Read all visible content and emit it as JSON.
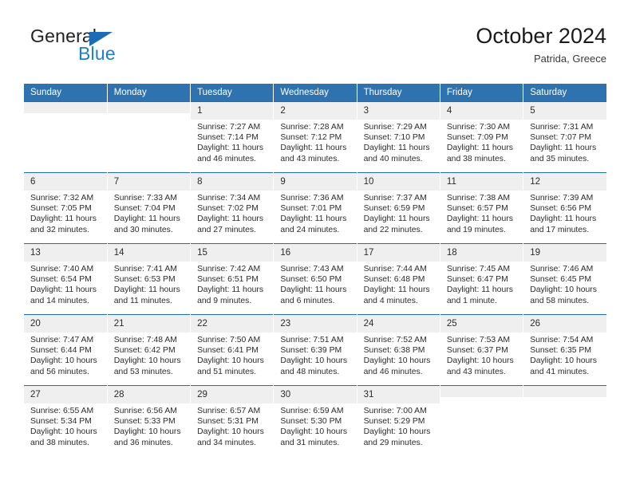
{
  "brand": {
    "name_top": "General",
    "name_bottom": "Blue",
    "triangle_color": "#1b6cb5",
    "text_color": "#231f20",
    "blue_color": "#1b7fd4"
  },
  "header": {
    "title": "October 2024",
    "subtitle": "Patrida, Greece"
  },
  "theme": {
    "header_blue": "#2e73b0",
    "row_divider_blue": "#1f6db5",
    "daynum_band": "#efefef",
    "text": "#2b2b2b"
  },
  "calendar": {
    "weekday_headers": [
      "Sunday",
      "Monday",
      "Tuesday",
      "Wednesday",
      "Thursday",
      "Friday",
      "Saturday"
    ],
    "labels": {
      "sunrise": "Sunrise:",
      "sunset": "Sunset:",
      "daylight": "Daylight:"
    },
    "weeks": [
      [
        {
          "day": "",
          "lines": []
        },
        {
          "day": "",
          "lines": []
        },
        {
          "day": "1",
          "lines": [
            "Sunrise: 7:27 AM",
            "Sunset: 7:14 PM",
            "Daylight: 11 hours and 46 minutes."
          ]
        },
        {
          "day": "2",
          "lines": [
            "Sunrise: 7:28 AM",
            "Sunset: 7:12 PM",
            "Daylight: 11 hours and 43 minutes."
          ]
        },
        {
          "day": "3",
          "lines": [
            "Sunrise: 7:29 AM",
            "Sunset: 7:10 PM",
            "Daylight: 11 hours and 40 minutes."
          ]
        },
        {
          "day": "4",
          "lines": [
            "Sunrise: 7:30 AM",
            "Sunset: 7:09 PM",
            "Daylight: 11 hours and 38 minutes."
          ]
        },
        {
          "day": "5",
          "lines": [
            "Sunrise: 7:31 AM",
            "Sunset: 7:07 PM",
            "Daylight: 11 hours and 35 minutes."
          ]
        }
      ],
      [
        {
          "day": "6",
          "lines": [
            "Sunrise: 7:32 AM",
            "Sunset: 7:05 PM",
            "Daylight: 11 hours and 32 minutes."
          ]
        },
        {
          "day": "7",
          "lines": [
            "Sunrise: 7:33 AM",
            "Sunset: 7:04 PM",
            "Daylight: 11 hours and 30 minutes."
          ]
        },
        {
          "day": "8",
          "lines": [
            "Sunrise: 7:34 AM",
            "Sunset: 7:02 PM",
            "Daylight: 11 hours and 27 minutes."
          ]
        },
        {
          "day": "9",
          "lines": [
            "Sunrise: 7:36 AM",
            "Sunset: 7:01 PM",
            "Daylight: 11 hours and 24 minutes."
          ]
        },
        {
          "day": "10",
          "lines": [
            "Sunrise: 7:37 AM",
            "Sunset: 6:59 PM",
            "Daylight: 11 hours and 22 minutes."
          ]
        },
        {
          "day": "11",
          "lines": [
            "Sunrise: 7:38 AM",
            "Sunset: 6:57 PM",
            "Daylight: 11 hours and 19 minutes."
          ]
        },
        {
          "day": "12",
          "lines": [
            "Sunrise: 7:39 AM",
            "Sunset: 6:56 PM",
            "Daylight: 11 hours and 17 minutes."
          ]
        }
      ],
      [
        {
          "day": "13",
          "lines": [
            "Sunrise: 7:40 AM",
            "Sunset: 6:54 PM",
            "Daylight: 11 hours and 14 minutes."
          ]
        },
        {
          "day": "14",
          "lines": [
            "Sunrise: 7:41 AM",
            "Sunset: 6:53 PM",
            "Daylight: 11 hours and 11 minutes."
          ]
        },
        {
          "day": "15",
          "lines": [
            "Sunrise: 7:42 AM",
            "Sunset: 6:51 PM",
            "Daylight: 11 hours and 9 minutes."
          ]
        },
        {
          "day": "16",
          "lines": [
            "Sunrise: 7:43 AM",
            "Sunset: 6:50 PM",
            "Daylight: 11 hours and 6 minutes."
          ]
        },
        {
          "day": "17",
          "lines": [
            "Sunrise: 7:44 AM",
            "Sunset: 6:48 PM",
            "Daylight: 11 hours and 4 minutes."
          ]
        },
        {
          "day": "18",
          "lines": [
            "Sunrise: 7:45 AM",
            "Sunset: 6:47 PM",
            "Daylight: 11 hours and 1 minute."
          ]
        },
        {
          "day": "19",
          "lines": [
            "Sunrise: 7:46 AM",
            "Sunset: 6:45 PM",
            "Daylight: 10 hours and 58 minutes."
          ]
        }
      ],
      [
        {
          "day": "20",
          "lines": [
            "Sunrise: 7:47 AM",
            "Sunset: 6:44 PM",
            "Daylight: 10 hours and 56 minutes."
          ]
        },
        {
          "day": "21",
          "lines": [
            "Sunrise: 7:48 AM",
            "Sunset: 6:42 PM",
            "Daylight: 10 hours and 53 minutes."
          ]
        },
        {
          "day": "22",
          "lines": [
            "Sunrise: 7:50 AM",
            "Sunset: 6:41 PM",
            "Daylight: 10 hours and 51 minutes."
          ]
        },
        {
          "day": "23",
          "lines": [
            "Sunrise: 7:51 AM",
            "Sunset: 6:39 PM",
            "Daylight: 10 hours and 48 minutes."
          ]
        },
        {
          "day": "24",
          "lines": [
            "Sunrise: 7:52 AM",
            "Sunset: 6:38 PM",
            "Daylight: 10 hours and 46 minutes."
          ]
        },
        {
          "day": "25",
          "lines": [
            "Sunrise: 7:53 AM",
            "Sunset: 6:37 PM",
            "Daylight: 10 hours and 43 minutes."
          ]
        },
        {
          "day": "26",
          "lines": [
            "Sunrise: 7:54 AM",
            "Sunset: 6:35 PM",
            "Daylight: 10 hours and 41 minutes."
          ]
        }
      ],
      [
        {
          "day": "27",
          "lines": [
            "Sunrise: 6:55 AM",
            "Sunset: 5:34 PM",
            "Daylight: 10 hours and 38 minutes."
          ]
        },
        {
          "day": "28",
          "lines": [
            "Sunrise: 6:56 AM",
            "Sunset: 5:33 PM",
            "Daylight: 10 hours and 36 minutes."
          ]
        },
        {
          "day": "29",
          "lines": [
            "Sunrise: 6:57 AM",
            "Sunset: 5:31 PM",
            "Daylight: 10 hours and 34 minutes."
          ]
        },
        {
          "day": "30",
          "lines": [
            "Sunrise: 6:59 AM",
            "Sunset: 5:30 PM",
            "Daylight: 10 hours and 31 minutes."
          ]
        },
        {
          "day": "31",
          "lines": [
            "Sunrise: 7:00 AM",
            "Sunset: 5:29 PM",
            "Daylight: 10 hours and 29 minutes."
          ]
        },
        {
          "day": "",
          "lines": []
        },
        {
          "day": "",
          "lines": []
        }
      ]
    ]
  }
}
